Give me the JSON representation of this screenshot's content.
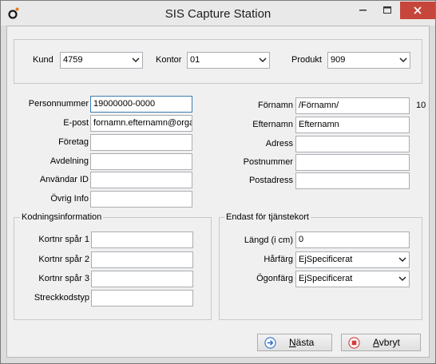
{
  "window": {
    "title": "SIS Capture Station"
  },
  "top": {
    "kund": {
      "label": "Kund",
      "value": "4759"
    },
    "kontor": {
      "label": "Kontor",
      "value": "01"
    },
    "produkt": {
      "label": "Produkt",
      "value": "909"
    }
  },
  "left_fields": [
    {
      "label": "Personnummer",
      "value": "19000000-0000"
    },
    {
      "label": "E-post",
      "value": "fornamn.efternamn@organ"
    },
    {
      "label": "Företag",
      "value": ""
    },
    {
      "label": "Avdelning",
      "value": ""
    },
    {
      "label": "Användar ID",
      "value": ""
    },
    {
      "label": "Övrig Info",
      "value": ""
    }
  ],
  "right_fields": [
    {
      "label": "Förnamn",
      "value": "/Förnamn/"
    },
    {
      "label": "Efternamn",
      "value": "Efternamn"
    },
    {
      "label": "Adress",
      "value": ""
    },
    {
      "label": "Postnummer",
      "value": ""
    },
    {
      "label": "Postadress",
      "value": ""
    }
  ],
  "fornamn_counter": "10",
  "coding": {
    "title": "Kodningsinformation",
    "fields": [
      {
        "label": "Kortnr spår 1",
        "value": ""
      },
      {
        "label": "Kortnr spår 2",
        "value": ""
      },
      {
        "label": "Kortnr spår 3",
        "value": ""
      },
      {
        "label": "Streckkodstyp",
        "value": ""
      }
    ]
  },
  "service_card": {
    "title": "Endast för tjänstekort",
    "length": {
      "label": "Längd (i cm)",
      "value": "0"
    },
    "hair": {
      "label": "Hårfärg",
      "value": "EjSpecificerat"
    },
    "eye": {
      "label": "Ögonfärg",
      "value": "EjSpecificerat"
    }
  },
  "buttons": {
    "next": {
      "first": "N",
      "rest": "ästa"
    },
    "cancel": {
      "first": "A",
      "rest": "vbryt"
    }
  },
  "colors": {
    "close_button": "#c7463c",
    "focus_border": "#3c7fb1",
    "next_icon": "#2f6fd0",
    "cancel_icon": "#d23c3c"
  }
}
